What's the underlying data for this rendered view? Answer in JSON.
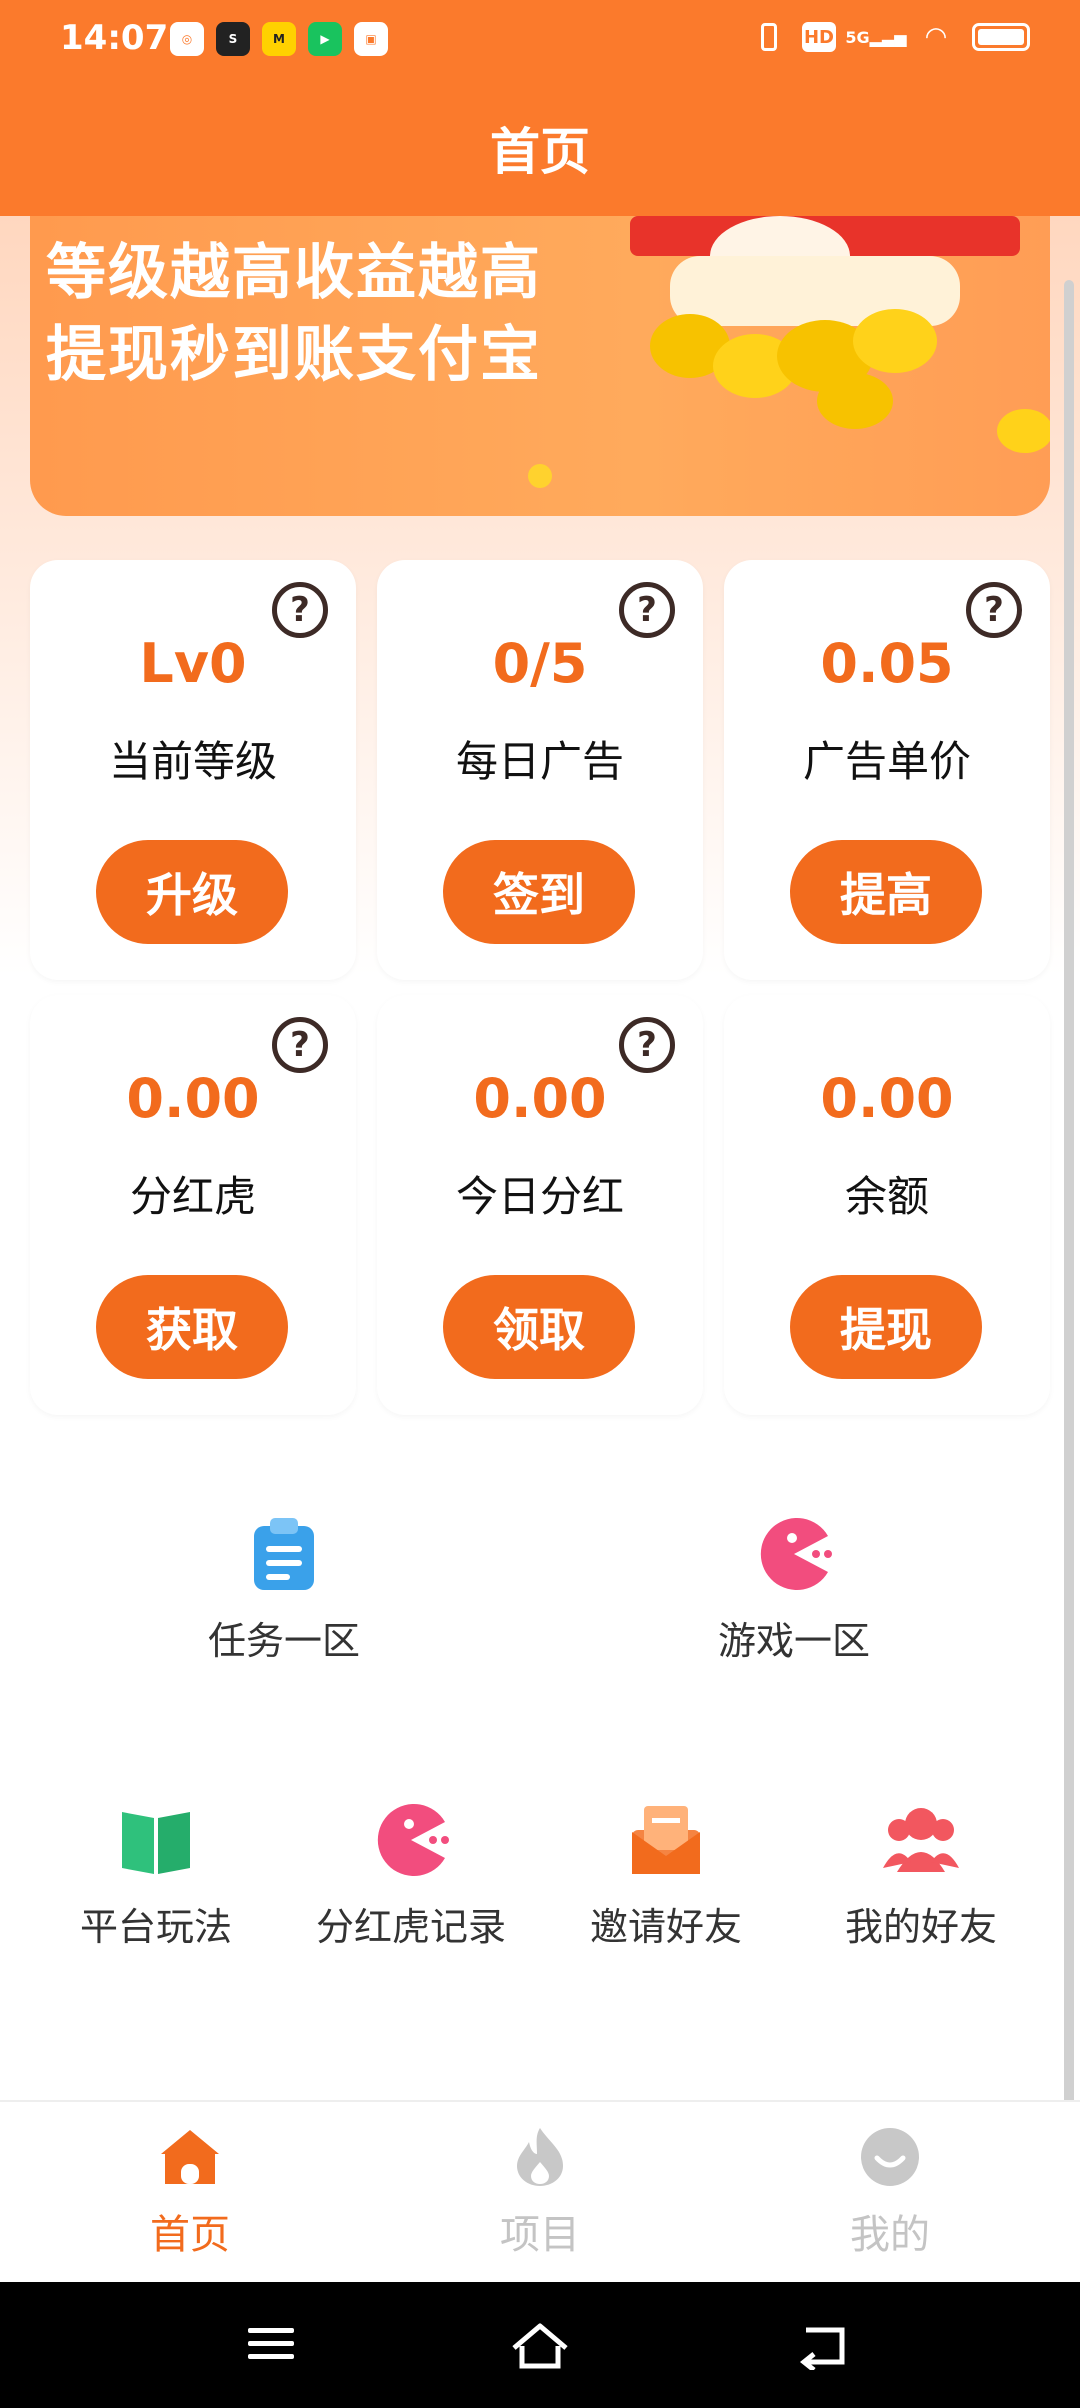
{
  "status_bar": {
    "time": "14:07",
    "app_icons": [
      "soul-app-icon",
      "meituan-app-icon",
      "video-app-icon",
      "shop-app-icon"
    ],
    "network": "5G",
    "hd_label": "HD"
  },
  "header": {
    "title": "首页"
  },
  "banner": {
    "line1": "等级越高收益越高",
    "line2": "提现秒到账支付宝"
  },
  "stats": [
    {
      "value": "Lv0",
      "label": "当前等级",
      "button": "升级",
      "has_help": true
    },
    {
      "value": "0/5",
      "label": "每日广告",
      "button": "签到",
      "has_help": true
    },
    {
      "value": "0.05",
      "label": "广告单价",
      "button": "提高",
      "has_help": true
    },
    {
      "value": "0.00",
      "label": "分红虎",
      "button": "获取",
      "has_help": true
    },
    {
      "value": "0.00",
      "label": "今日分红",
      "button": "领取",
      "has_help": true
    },
    {
      "value": "0.00",
      "label": "余额",
      "button": "提现",
      "has_help": false
    }
  ],
  "zones": [
    {
      "label": "任务一区",
      "icon": "clipboard-icon"
    },
    {
      "label": "游戏一区",
      "icon": "pacman-icon"
    }
  ],
  "quick_links": [
    {
      "label": "平台玩法",
      "icon": "book-icon"
    },
    {
      "label": "分红虎记录",
      "icon": "pacman-icon"
    },
    {
      "label": "邀请好友",
      "icon": "envelope-icon"
    },
    {
      "label": "我的好友",
      "icon": "friends-icon"
    }
  ],
  "bottom_nav": [
    {
      "label": "首页",
      "icon": "home-icon",
      "active": true
    },
    {
      "label": "项目",
      "icon": "fire-icon",
      "active": false
    },
    {
      "label": "我的",
      "icon": "smile-icon",
      "active": false
    }
  ],
  "colors": {
    "primary": "#fb7a2c",
    "accent": "#f26b1d",
    "inactive": "#c4c4c4"
  }
}
